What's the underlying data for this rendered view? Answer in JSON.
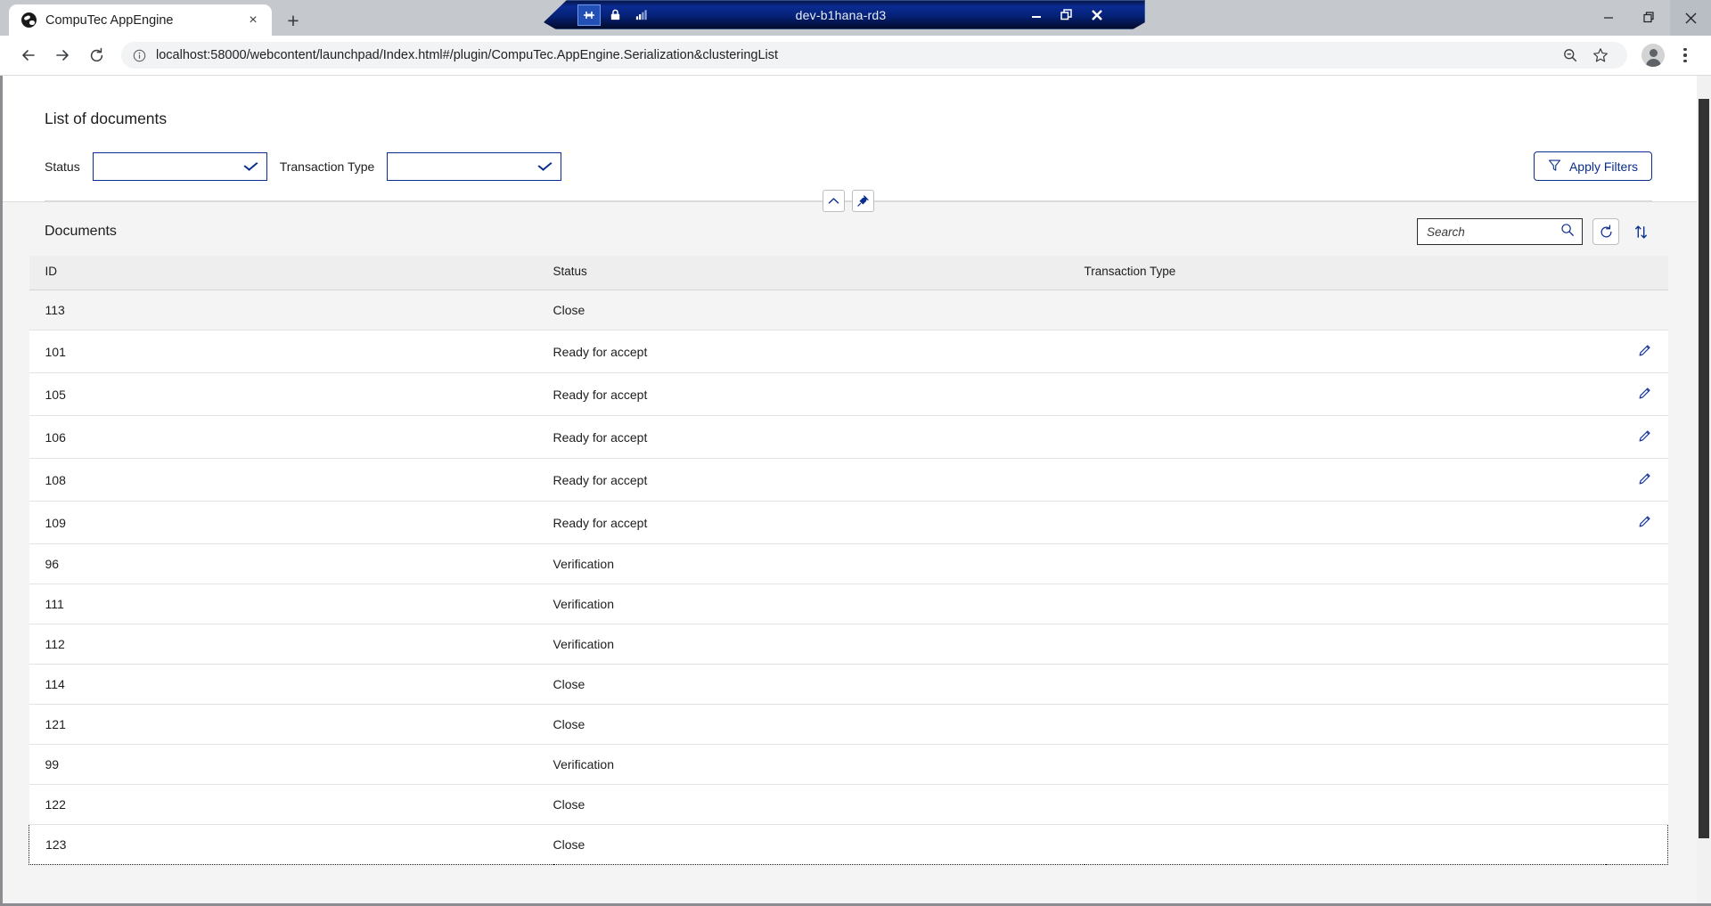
{
  "browser": {
    "tab": {
      "title": "CompuTec AppEngine",
      "favicon": "globe-icon",
      "close": "×"
    },
    "new_tab_label": "+",
    "omnibox": {
      "url": "localhost:58000/webcontent/launchpad/Index.html#/plugin/CompuTec.AppEngine.Serialization&clusteringList",
      "info_icon": "info-circle-icon",
      "zoom_out_icon": "zoom-out-icon",
      "bookmark_icon": "star-icon",
      "profile_icon": "avatar-icon",
      "menu_icon": "kebab-menu-icon"
    },
    "nav": {
      "back": "←",
      "forward": "→",
      "reload": "⟳"
    },
    "window_controls": {
      "minimize": "—",
      "maximize": "❐",
      "close": "✕"
    }
  },
  "rdp_bar": {
    "title": "dev-b1hana-rd3",
    "icons": [
      "pin-icon",
      "lock-icon",
      "signal-icon"
    ],
    "buttons": {
      "minimize": "—",
      "restore": "❐",
      "close": "✕"
    }
  },
  "page": {
    "title": "List of documents",
    "filters": {
      "status": {
        "label": "Status",
        "value": "",
        "options": []
      },
      "transaction_type": {
        "label": "Transaction Type",
        "value": "",
        "options": []
      },
      "apply_button": {
        "label": "Apply Filters",
        "icon": "filter-funnel-icon"
      }
    },
    "collapse_controls": {
      "collapse": "chevron-up-icon",
      "pin": "pin-icon"
    },
    "panel": {
      "title": "Documents",
      "search": {
        "value": "",
        "placeholder": "Search",
        "icon": "search-icon"
      },
      "refresh": "refresh-icon",
      "sort": "sort-arrows-icon"
    },
    "table": {
      "columns": [
        "ID",
        "Status",
        "Transaction Type",
        ""
      ],
      "rows": [
        {
          "id": "113",
          "status": "Close",
          "transaction_type": "",
          "edit": false,
          "selected": true,
          "focused": false
        },
        {
          "id": "101",
          "status": "Ready for accept",
          "transaction_type": "",
          "edit": true,
          "selected": false,
          "focused": false
        },
        {
          "id": "105",
          "status": "Ready for accept",
          "transaction_type": "",
          "edit": true,
          "selected": false,
          "focused": false
        },
        {
          "id": "106",
          "status": "Ready for accept",
          "transaction_type": "",
          "edit": true,
          "selected": false,
          "focused": false
        },
        {
          "id": "108",
          "status": "Ready for accept",
          "transaction_type": "",
          "edit": true,
          "selected": false,
          "focused": false
        },
        {
          "id": "109",
          "status": "Ready for accept",
          "transaction_type": "",
          "edit": true,
          "selected": false,
          "focused": false
        },
        {
          "id": "96",
          "status": "Verification",
          "transaction_type": "",
          "edit": false,
          "selected": false,
          "focused": false
        },
        {
          "id": "111",
          "status": "Verification",
          "transaction_type": "",
          "edit": false,
          "selected": false,
          "focused": false
        },
        {
          "id": "112",
          "status": "Verification",
          "transaction_type": "",
          "edit": false,
          "selected": false,
          "focused": false
        },
        {
          "id": "114",
          "status": "Close",
          "transaction_type": "",
          "edit": false,
          "selected": false,
          "focused": false
        },
        {
          "id": "121",
          "status": "Close",
          "transaction_type": "",
          "edit": false,
          "selected": false,
          "focused": false
        },
        {
          "id": "99",
          "status": "Verification",
          "transaction_type": "",
          "edit": false,
          "selected": false,
          "focused": false
        },
        {
          "id": "122",
          "status": "Close",
          "transaction_type": "",
          "edit": false,
          "selected": false,
          "focused": false
        },
        {
          "id": "123",
          "status": "Close",
          "transaction_type": "",
          "edit": false,
          "selected": false,
          "focused": true
        }
      ]
    }
  },
  "colors": {
    "accent_blue": "#0a2d8f",
    "rdp_blue": "#0a2b92",
    "panel_bg": "#f4f4f4",
    "header_bg": "#eeeeee"
  }
}
